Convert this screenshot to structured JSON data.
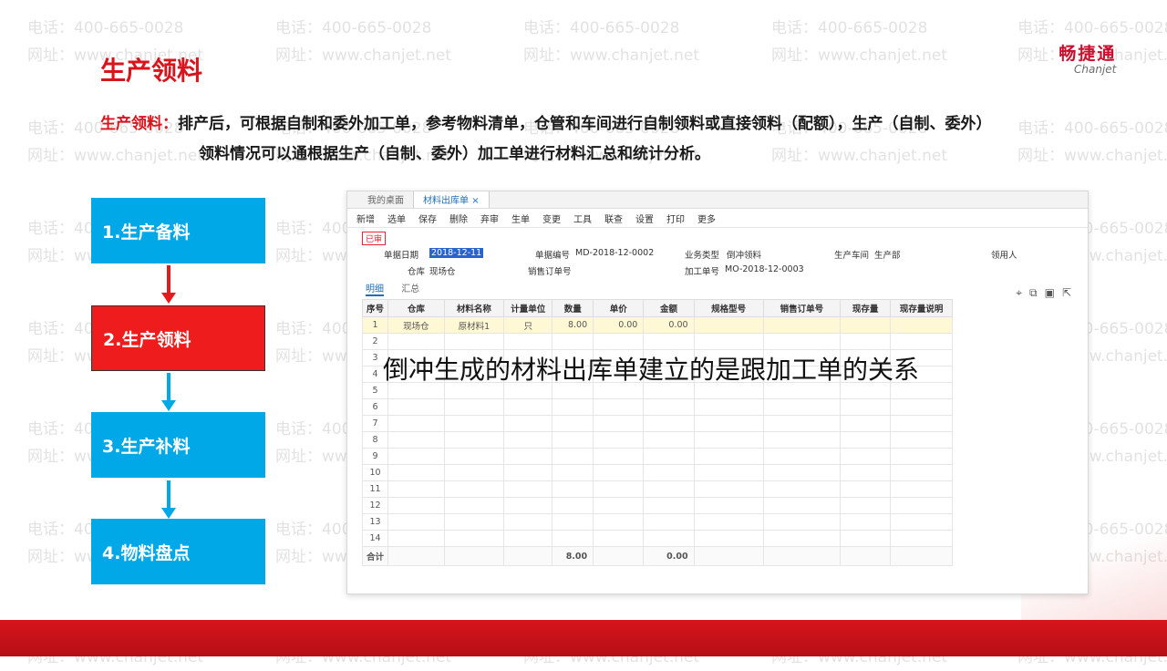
{
  "slide": {
    "title": "生产领料",
    "logo_cn": "畅捷通",
    "logo_en": "Chanjet",
    "desc_label": "生产领料：",
    "desc_line1": "排产后，可根据自制和委外加工单，参考物料清单，仓管和车间进行自制领料或直接领料（配额），生产（自制、委外）",
    "desc_line2": "领料情况可以通根据生产（自制、委外）加工单进行材料汇总和统计分析。",
    "overlay_caption": "倒冲生成的材料出库单建立的是跟加工单的关系"
  },
  "watermark": {
    "phone": "电话：400-665-0028",
    "site": "网址：www.chanjet.net"
  },
  "steps": [
    {
      "label": "1.生产备料",
      "active": false
    },
    {
      "label": "2.生产领料",
      "active": true
    },
    {
      "label": "3.生产补料",
      "active": false
    },
    {
      "label": "4.物料盘点",
      "active": false
    }
  ],
  "colors": {
    "brand_red": "#d8141c",
    "step_blue": "#00a8e8",
    "step_active": "#ee1c1c"
  },
  "app": {
    "tabs": [
      "我的桌面",
      "材料出库单"
    ],
    "toolbar": [
      "新增",
      "选单",
      "保存",
      "删除",
      "弃审",
      "生单",
      "变更",
      "工具",
      "联查",
      "设置",
      "打印",
      "更多"
    ],
    "status_badge": "已审",
    "fields": {
      "date_label": "单据日期",
      "date_value": "2018-12-11",
      "docno_label": "单据编号",
      "docno_value": "MD-2018-12-0002",
      "biz_label": "业务类型",
      "biz_value": "倒冲领料",
      "workshop_label": "生产车间",
      "workshop_value": "生产部",
      "receiver_label": "领用人",
      "warehouse_label": "仓库",
      "warehouse_value": "现场仓",
      "saleorder_label": "销售订单号",
      "workorder_label": "加工单号",
      "workorder_value": "MO-2018-12-0003"
    },
    "subtabs": [
      "明细",
      "汇总"
    ],
    "grid": {
      "columns": [
        "序号",
        "仓库",
        "材料名称",
        "计量单位",
        "数量",
        "单价",
        "金额",
        "规格型号",
        "销售订单号",
        "现存量",
        "现存量说明"
      ],
      "rows": [
        [
          "1",
          "现场仓",
          "原材料1",
          "只",
          "8.00",
          "0.00",
          "0.00",
          "",
          "",
          "",
          ""
        ],
        [
          "2",
          "",
          "",
          "",
          "",
          "",
          "",
          "",
          "",
          "",
          ""
        ],
        [
          "3",
          "",
          "",
          "",
          "",
          "",
          "",
          "",
          "",
          "",
          ""
        ],
        [
          "4",
          "",
          "",
          "",
          "",
          "",
          "",
          "",
          "",
          "",
          ""
        ],
        [
          "5",
          "",
          "",
          "",
          "",
          "",
          "",
          "",
          "",
          "",
          ""
        ],
        [
          "6",
          "",
          "",
          "",
          "",
          "",
          "",
          "",
          "",
          "",
          ""
        ],
        [
          "7",
          "",
          "",
          "",
          "",
          "",
          "",
          "",
          "",
          "",
          ""
        ],
        [
          "8",
          "",
          "",
          "",
          "",
          "",
          "",
          "",
          "",
          "",
          ""
        ],
        [
          "9",
          "",
          "",
          "",
          "",
          "",
          "",
          "",
          "",
          "",
          ""
        ],
        [
          "10",
          "",
          "",
          "",
          "",
          "",
          "",
          "",
          "",
          "",
          ""
        ],
        [
          "11",
          "",
          "",
          "",
          "",
          "",
          "",
          "",
          "",
          "",
          ""
        ],
        [
          "12",
          "",
          "",
          "",
          "",
          "",
          "",
          "",
          "",
          "",
          ""
        ],
        [
          "13",
          "",
          "",
          "",
          "",
          "",
          "",
          "",
          "",
          "",
          ""
        ],
        [
          "14",
          "",
          "",
          "",
          "",
          "",
          "",
          "",
          "",
          "",
          ""
        ]
      ],
      "total_label": "合计",
      "total_qty": "8.00",
      "total_amount": "0.00"
    }
  }
}
